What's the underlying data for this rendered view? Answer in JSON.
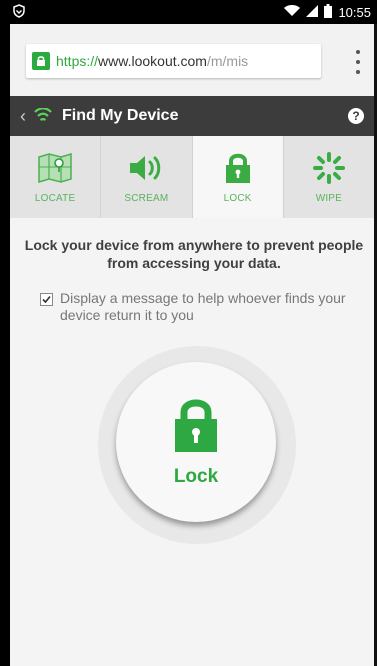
{
  "status_bar": {
    "time": "10:55",
    "icons": [
      "shield-icon",
      "wifi-icon",
      "signal-icon",
      "battery-icon"
    ]
  },
  "browser": {
    "url_scheme": "https://",
    "url_host": "www.lookout.com",
    "url_path": "/m/miѕ"
  },
  "app_header": {
    "title": "Find My Device",
    "help": "?"
  },
  "tabs": [
    {
      "label": "LOCATE",
      "icon": "map-icon",
      "active": false
    },
    {
      "label": "SCREAM",
      "icon": "speaker-icon",
      "active": false
    },
    {
      "label": "LOCK",
      "icon": "lock-icon",
      "active": true
    },
    {
      "label": "WIPE",
      "icon": "spinner-icon",
      "active": false
    }
  ],
  "content": {
    "lead_text": "Lock your device from anywhere to prevent people from accessing your data.",
    "checkbox_label": "Display a message to help whoever finds your device return it to you",
    "checkbox_checked": true,
    "lock_button_label": "Lock"
  },
  "colors": {
    "accent": "#2ea843",
    "header_bg": "#3c3c3c"
  }
}
